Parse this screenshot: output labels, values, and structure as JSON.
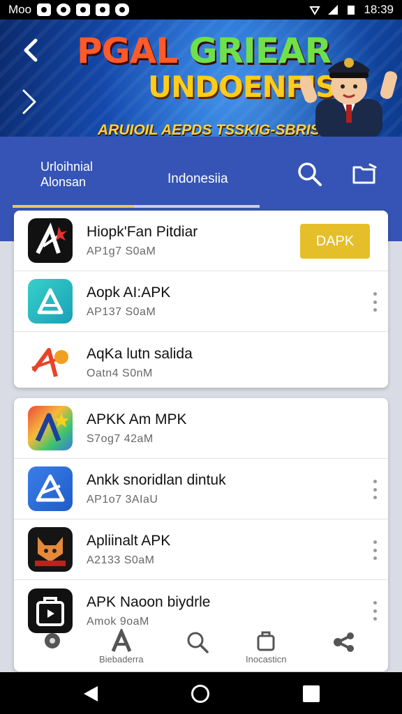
{
  "status_bar": {
    "carrier": "Moo",
    "time": "18:39"
  },
  "banner": {
    "title_part1": "PGAL",
    "title_part2": "GRIEAR",
    "subtitle": "UNDOENFISI",
    "tagline": "ARUIOIL AEPDS TSSKIG-SBRIS"
  },
  "tabs": {
    "tab1_line1": "Urloihnial",
    "tab1_line2": "Alonsan",
    "tab2": "Indonesiia"
  },
  "card1": {
    "rows": [
      {
        "name": "Hiopk'Fan Pitdiar",
        "meta": "AP1g7 S0aM",
        "action": "DAPK"
      },
      {
        "name": "Aopk AI:APK",
        "meta": "AP137 S0aM"
      },
      {
        "name": "AqKa lutn salida",
        "meta": "Oatn4 S0nM"
      }
    ]
  },
  "card2": {
    "rows": [
      {
        "name": "APKK Am MPK",
        "meta": "S7og7 42aM"
      },
      {
        "name": "Ankk snoridlan dintuk",
        "meta": "AP1o7 3AIaU"
      },
      {
        "name": "Apliinalt APK",
        "meta": "A2133 S0aM"
      },
      {
        "name": "APK Naoon biydrle",
        "meta": "Amok 9oaM"
      }
    ]
  },
  "bottom_nav": {
    "item2_label": "Biebaderra",
    "item4_label": "Inocasticn"
  },
  "colors": {
    "header_blue": "#3554b5",
    "download_yellow": "#e5bf2a",
    "tab_indicator": "#e8c75a"
  }
}
